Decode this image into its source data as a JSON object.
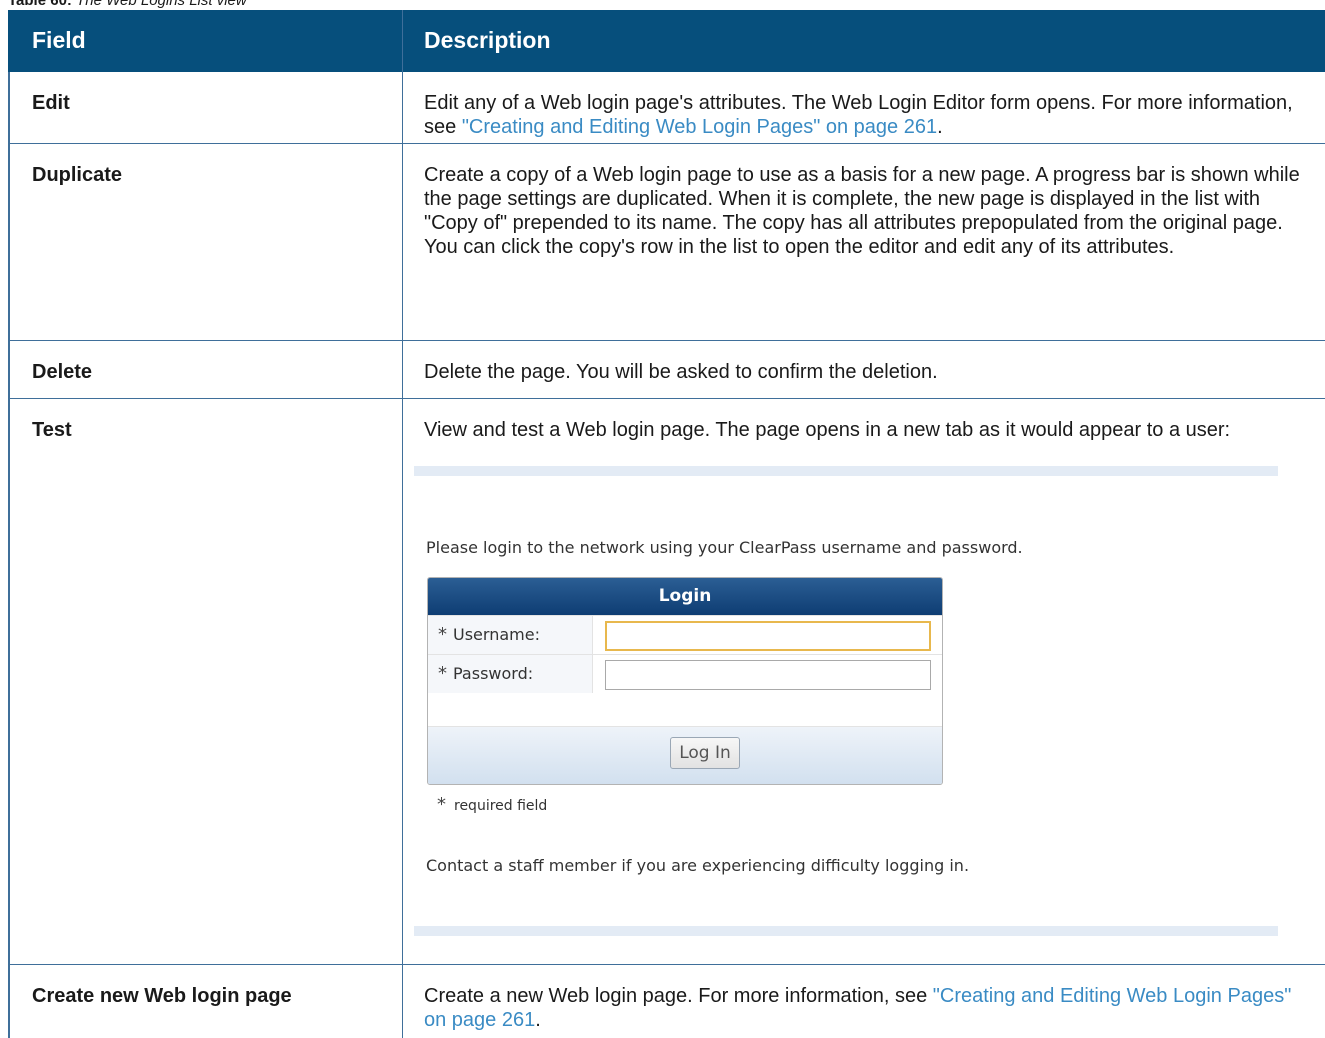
{
  "caption": {
    "label": "Table 60:",
    "title": "The Web Logins List view"
  },
  "header": {
    "field": "Field",
    "description": "Description"
  },
  "rows": [
    {
      "field": "Edit",
      "desc_before": "Edit any of a Web login page's attributes. The Web Login Editor form opens. For more information, see ",
      "link": "\"Creating and Editing Web Login Pages\" on page 261",
      "desc_after": "."
    },
    {
      "field": "Duplicate",
      "desc": "Create a copy of a Web login page to use as a basis for a new page. A progress bar is shown while the page settings are duplicated. When it is complete, the new page is displayed in the list with \"Copy of\" prepended to its name. The copy has all attributes prepopulated from the original page. You can click the copy's row in the list to open the editor and edit any of its attributes."
    },
    {
      "field": "Delete",
      "desc": "Delete the page. You will be asked to confirm the deletion."
    },
    {
      "field": "Test",
      "desc": "View and test a Web login page. The page opens in a new tab as it would appear to a user:"
    },
    {
      "field": "Create new Web login page",
      "desc_before": "Create a new Web login page. For more information, see ",
      "link": "\"Creating and Editing Web Login Pages\" on page 261",
      "desc_after": "."
    }
  ],
  "login_preview": {
    "intro": "Please login to the network using your ClearPass username and password.",
    "title": "Login",
    "required_marker": "*",
    "username_label": "Username:",
    "password_label": "Password:",
    "button": "Log In",
    "required_note": "required field",
    "footer": "Contact a staff member if you are experiencing difficulty logging in."
  }
}
